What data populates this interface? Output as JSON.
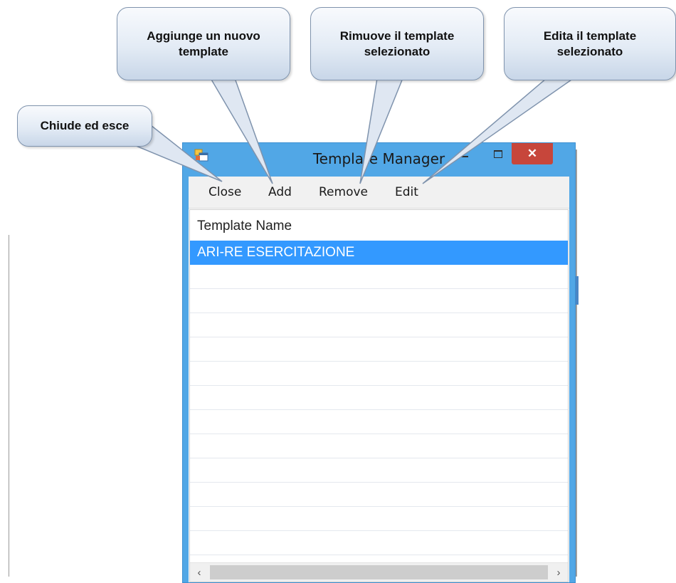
{
  "window": {
    "title": "Template Manager",
    "close_glyph": "✕",
    "app_icon": "form-app-icon"
  },
  "menu": {
    "close": "Close",
    "add": "Add",
    "remove": "Remove",
    "edit": "Edit"
  },
  "list": {
    "column_header": "Template Name",
    "rows": [
      "ARI-RE ESERCITAZIONE",
      "",
      "",
      "",
      "",
      "",
      "",
      "",
      "",
      "",
      "",
      "",
      ""
    ],
    "selected_index": 0
  },
  "scrollbar": {
    "left_arrow": "‹",
    "right_arrow": "›"
  },
  "callouts": {
    "close": "Chiude ed esce",
    "add_line1": "Aggiunge un nuovo",
    "add_line2": "template",
    "remove_line1": "Rimuove il template",
    "remove_line2": "selezionato",
    "edit_line1": "Edita il template",
    "edit_line2": "selezionato"
  },
  "colors": {
    "window_frame": "#51a7e6",
    "close_button": "#c7463b",
    "selection": "#3399ff",
    "callout_border": "#7f93ad"
  }
}
